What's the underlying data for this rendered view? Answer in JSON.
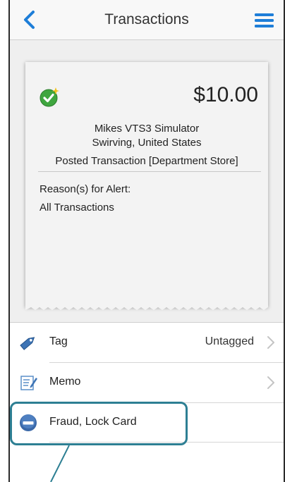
{
  "navbar": {
    "title": "Transactions",
    "back_icon": "chevron-left-icon",
    "menu_icon": "hamburger-menu-icon"
  },
  "transaction": {
    "status_icon": "check-sparkle-icon",
    "amount": "$10.00",
    "merchant": "Mikes VTS3 Simulator",
    "location": "Swirving, United States",
    "posted": "Posted Transaction [Department Store]",
    "reason_label": "Reason(s) for Alert:",
    "reason_value": "All Transactions"
  },
  "actions": [
    {
      "icon": "tag-icon",
      "label": "Tag",
      "value": "Untagged",
      "chevron": true
    },
    {
      "icon": "memo-icon",
      "label": "Memo",
      "value": "",
      "chevron": true
    },
    {
      "icon": "minus-circle-icon",
      "label": "Fraud, Lock Card",
      "value": "",
      "chevron": false
    }
  ],
  "colors": {
    "accent_blue": "#1e7ed8",
    "highlight_teal": "#2d7f93",
    "check_green": "#3fa63f"
  }
}
